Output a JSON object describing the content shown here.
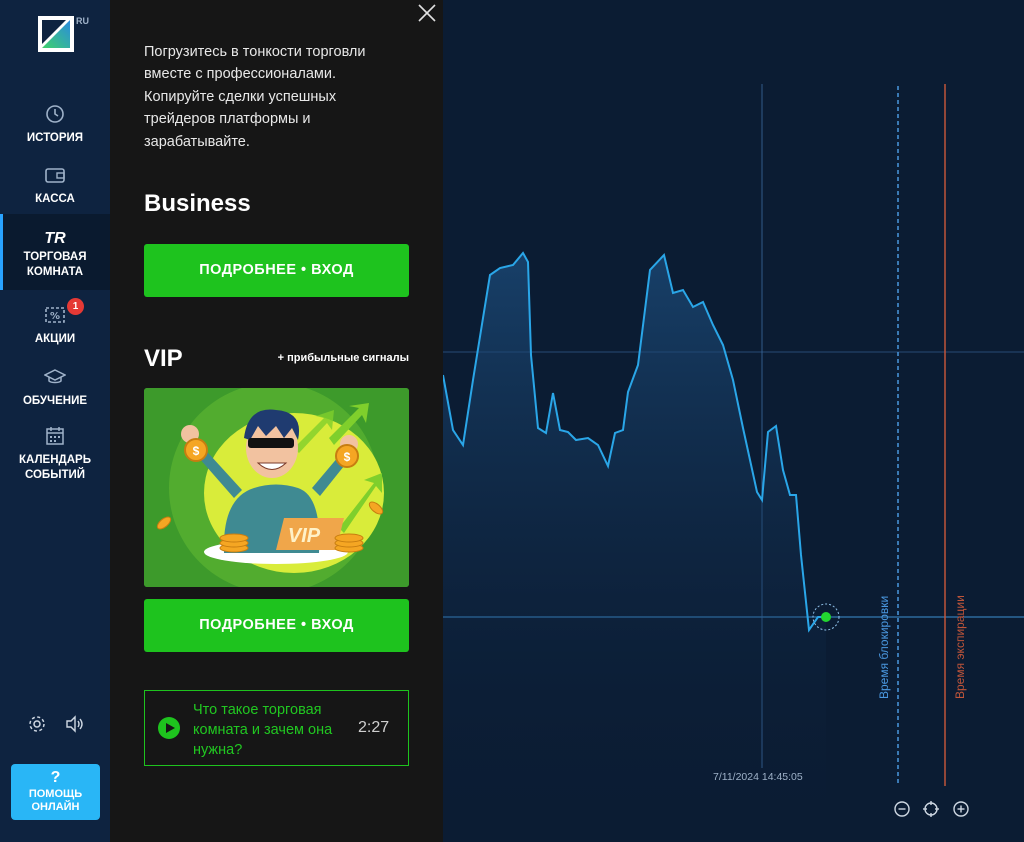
{
  "sidebar": {
    "logo_region": "RU",
    "items": [
      {
        "label": "ИСТОРИЯ",
        "icon": "history-icon"
      },
      {
        "label": "КАССА",
        "icon": "wallet-icon"
      },
      {
        "label_1": "ТОРГОВАЯ",
        "label_2": "КОМНАТА",
        "icon_text": "TR",
        "icon": "trading-room-icon",
        "active": true
      },
      {
        "label": "АКЦИИ",
        "icon": "percent-icon",
        "badge": "1"
      },
      {
        "label": "ОБУЧЕНИЕ",
        "icon": "graduation-cap-icon"
      },
      {
        "label_1": "КАЛЕНДАРЬ",
        "label_2": "СОБЫТИЙ",
        "icon": "calendar-icon"
      }
    ],
    "help": {
      "q": "?",
      "line1": "ПОМОЩЬ",
      "line2": "ОНЛАЙН"
    }
  },
  "panel": {
    "intro": "Погрузитесь в тонкости торговли вместе с профессионалами. Копируйте сделки успешных трейдеров платформы и зарабатывайте.",
    "business": {
      "title": "Business",
      "button": "ПОДРОБНЕЕ • ВХОД"
    },
    "vip": {
      "title": "VIP",
      "tag": "+ прибыльные сигналы",
      "button": "ПОДРОБНЕЕ • ВХОД",
      "image_text": "VIP"
    },
    "video": {
      "text": "Что такое торговая комната и зачем она нужна?",
      "duration": "2:27"
    }
  },
  "chart": {
    "timestamp": "7/11/2024 14:45:05",
    "lock_label": "Время блокировки",
    "expiry_label": "Время экспирации",
    "colors": {
      "line": "#2aa6e8",
      "lock": "#3d87c9",
      "expiry": "#c0553a",
      "point": "#23d630"
    }
  }
}
